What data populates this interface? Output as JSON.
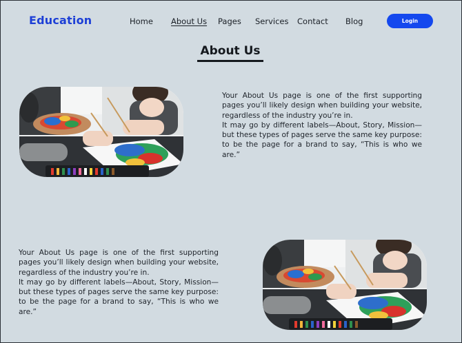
{
  "brand": {
    "name": "Education"
  },
  "nav": {
    "items": [
      {
        "label": "Home",
        "active": false
      },
      {
        "label": "About Us",
        "active": true
      },
      {
        "label": "Pages",
        "active": false
      },
      {
        "label": "Services",
        "active": false
      },
      {
        "label": "Contact",
        "active": false
      },
      {
        "label": "Blog",
        "active": false
      }
    ],
    "login_label": "Login"
  },
  "page": {
    "title": "About Us"
  },
  "sections": [
    {
      "image": "children-painting-photo",
      "paragraphs": [
        "Your About Us page is one of the first supporting pages you’ll likely design when building your website, regardless of the industry you’re in.",
        "It may go by different labels—About, Story, Mission—but these types of pages serve the same key purpose: to be the page for a brand to say, “This is who we are.”"
      ]
    },
    {
      "image": "children-painting-photo",
      "paragraphs": [
        "Your About Us page is one of the first supporting pages you’ll likely design when building your website, regardless of the industry you’re in.",
        "It may go by different labels—About, Story, Mission—but these types of pages serve the same key purpose: to be the page for a brand to say, “This is who we are.”"
      ]
    }
  ],
  "colors": {
    "background": "#d2dbe1",
    "brand": "#1d3fd6",
    "login_button": "#1448ee",
    "text": "#1a1f26"
  }
}
